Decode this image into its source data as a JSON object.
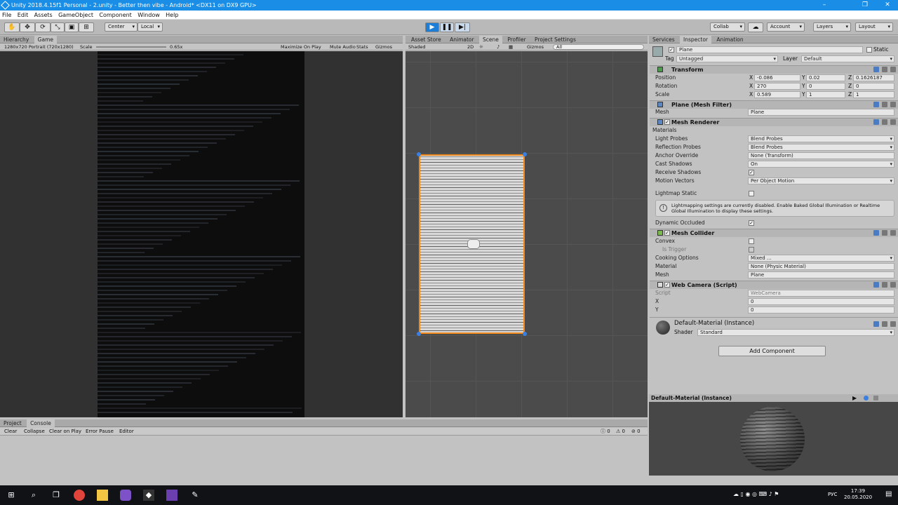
{
  "window": {
    "title": "Unity 2018.4.15f1 Personal - 2.unity - Better then vibe - Android* <DX11 on DX9 GPU>",
    "min": "–",
    "max": "❐",
    "close": "✕"
  },
  "menu": [
    "File",
    "Edit",
    "Assets",
    "GameObject",
    "Component",
    "Window",
    "Help"
  ],
  "toolbar": {
    "pivot": "Center",
    "space": "Local",
    "collab": "Collab",
    "account": "Account",
    "layers": "Layers",
    "layout": "Layout"
  },
  "left_tabs": [
    "Hierarchy",
    "Game"
  ],
  "game": {
    "resolution": "1280x720 Portrait (720x1280)",
    "scale_label": "Scale",
    "scale_value": "0.65x",
    "maximize": "Maximize On Play",
    "mute": "Mute Audio",
    "stats": "Stats",
    "gizmos": "Gizmos"
  },
  "center_tabs": [
    "Asset Store",
    "Animator",
    "Scene",
    "Profiler",
    "Project Settings"
  ],
  "scene": {
    "shaded": "Shaded",
    "mode2d": "2D",
    "gizmos": "Gizmos",
    "search": "All"
  },
  "right_tabs": [
    "Services",
    "Inspector",
    "Animation"
  ],
  "inspector": {
    "name": "Plane",
    "static": "Static",
    "tag_label": "Tag",
    "tag": "Untagged",
    "layer_label": "Layer",
    "layer": "Default",
    "transform": {
      "title": "Transform",
      "rows": [
        {
          "label": "Position",
          "x": "-0.086",
          "y": "0.02",
          "z": "0.1626187"
        },
        {
          "label": "Rotation",
          "x": "270",
          "y": "0",
          "z": "0"
        },
        {
          "label": "Scale",
          "x": "0.589",
          "y": "1",
          "z": "1"
        }
      ]
    },
    "meshfilter": {
      "title": "Plane (Mesh Filter)",
      "mesh_label": "Mesh",
      "mesh": "Plane"
    },
    "meshrenderer": {
      "title": "Mesh Renderer",
      "materials": "Materials",
      "light_probes_label": "Light Probes",
      "light_probes": "Blend Probes",
      "refl_label": "Reflection Probes",
      "refl": "Blend Probes",
      "anchor_label": "Anchor Override",
      "anchor": "None (Transform)",
      "cast_label": "Cast Shadows",
      "cast": "On",
      "receive_label": "Receive Shadows",
      "motion_label": "Motion Vectors",
      "motion": "Per Object Motion",
      "lightmap_label": "Lightmap Static",
      "info": "Lightmapping settings are currently disabled. Enable Baked Global Illumination or Realtime Global Illumination to display these settings.",
      "dyn_label": "Dynamic Occluded"
    },
    "meshcollider": {
      "title": "Mesh Collider",
      "convex_label": "Convex",
      "trigger_label": "Is Trigger",
      "cooking_label": "Cooking Options",
      "cooking": "Mixed ...",
      "material_label": "Material",
      "material": "None (Physic Material)",
      "mesh_label": "Mesh",
      "mesh": "Plane"
    },
    "webcam": {
      "title": "Web Camera (Script)",
      "script_label": "Script",
      "script": "WebCamera",
      "x_label": "X",
      "x": "0",
      "y_label": "Y",
      "y": "0"
    },
    "material": {
      "title": "Default-Material (Instance)",
      "shader_label": "Shader",
      "shader": "Standard"
    },
    "add_component": "Add Component"
  },
  "preview": {
    "title": "Default-Material (Instance)"
  },
  "bottom_tabs": [
    "Project",
    "Console"
  ],
  "console": {
    "clear": "Clear",
    "collapse": "Collapse",
    "clear_on_play": "Clear on Play",
    "error_pause": "Error Pause",
    "editor": "Editor",
    "c1": "0",
    "c2": "0",
    "c3": "0"
  },
  "taskbar": {
    "time": "17:39",
    "date": "20.05.2020",
    "lang": "РУС"
  },
  "colors": {
    "accent": "#1a8ee6",
    "selection": "#f08a1c"
  }
}
